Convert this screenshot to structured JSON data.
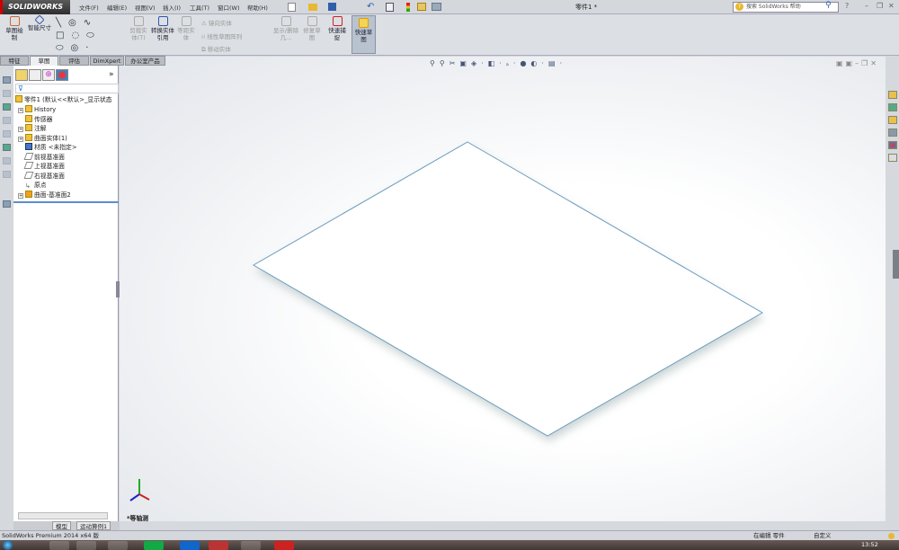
{
  "app": {
    "logo": "SOLIDWORKS",
    "document_title": "零件1 *",
    "help_search_placeholder": "搜索 SolidWorks 帮助"
  },
  "menu": [
    "文件(F)",
    "编辑(E)",
    "视图(V)",
    "插入(I)",
    "工具(T)",
    "窗口(W)",
    "帮助(H)"
  ],
  "toolbar": {
    "sketch": "草图绘制",
    "smart_dim": "智能尺寸",
    "trim": "剪裁实体(T)",
    "convert": "转换实体引用",
    "offset": "等距实体",
    "mirror": "镜向实体",
    "linear_pattern": "线性草图阵列",
    "move": "移动实体",
    "display_delete": "显示/删除几...",
    "repair": "修复草图",
    "quick_snap": "快速捕捉",
    "rapid_sketch": "快速草图"
  },
  "tabs": [
    "特征",
    "草图",
    "评估",
    "DimXpert",
    "办公室产品"
  ],
  "active_tab": 1,
  "tree": {
    "root": "零件1 (默认<<默认>_显示状态",
    "items": [
      "History",
      "传感器",
      "注解",
      "曲面实体(1)",
      "材质 <未指定>",
      "前视基准面",
      "上视基准面",
      "右视基准面",
      "原点",
      "曲面-基准面2"
    ]
  },
  "viewport": {
    "view_label": "*等轴测"
  },
  "bottom_tabs": [
    "模型",
    "运动算例1"
  ],
  "status": {
    "product": "SolidWorks Premium 2014 x64 版",
    "editing": "在编辑 零件",
    "custom": "自定义"
  },
  "taskbar": {
    "time": "13:52"
  },
  "colors": {
    "accent": "#c00000",
    "plane_edge": "#6a9cc0"
  }
}
